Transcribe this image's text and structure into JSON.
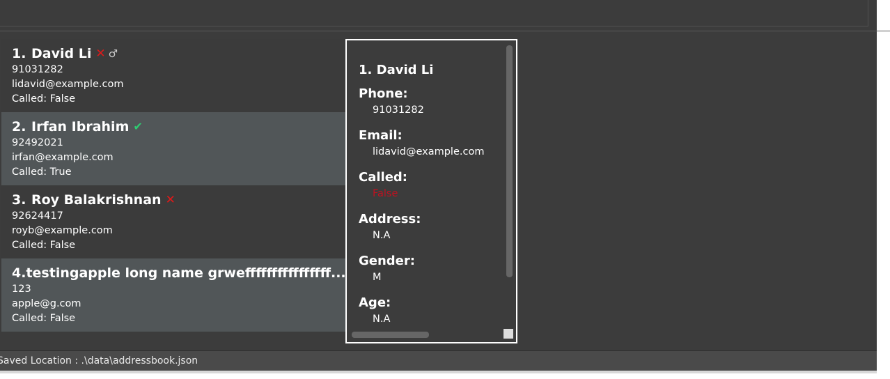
{
  "person_list": [
    {
      "index": "1.",
      "name": "David Li",
      "phone": "91031282",
      "email": "lidavid@example.com",
      "called": "Called: False",
      "call_mark": "✕",
      "gender_mark": "♂"
    },
    {
      "index": "2.",
      "name": "Irfan Ibrahim",
      "phone": "92492021",
      "email": "irfan@example.com",
      "called": "Called: True",
      "call_mark": "✔",
      "gender_mark": ""
    },
    {
      "index": "3.",
      "name": "Roy Balakrishnan",
      "phone": "92624417",
      "email": "royb@example.com",
      "called": "Called: False",
      "call_mark": "✕",
      "gender_mark": ""
    },
    {
      "index": "4.",
      "name": "testingapple long name grweffffffffffffffff...",
      "phone": "123",
      "email": "apple@g.com",
      "called": "Called: False",
      "call_mark": "…",
      "gender_mark": "♀"
    }
  ],
  "detail": {
    "name": "1.  David Li",
    "phone_label": "Phone:",
    "phone": "91031282",
    "email_label": "Email:",
    "email": "lidavid@example.com",
    "called_label": "Called:",
    "called": "False",
    "address_label": "Address:",
    "address": "N.A",
    "gender_label": "Gender:",
    "gender": "M",
    "age_label": "Age:",
    "age": "N.A"
  },
  "status_bar": {
    "save_location": "Saved Location : .\\data\\addressbook.json"
  },
  "colors": {
    "background": "#3c3c3c",
    "card_alt": "#515658",
    "called_false": "#e01919",
    "called_true": "#2ecc71"
  }
}
